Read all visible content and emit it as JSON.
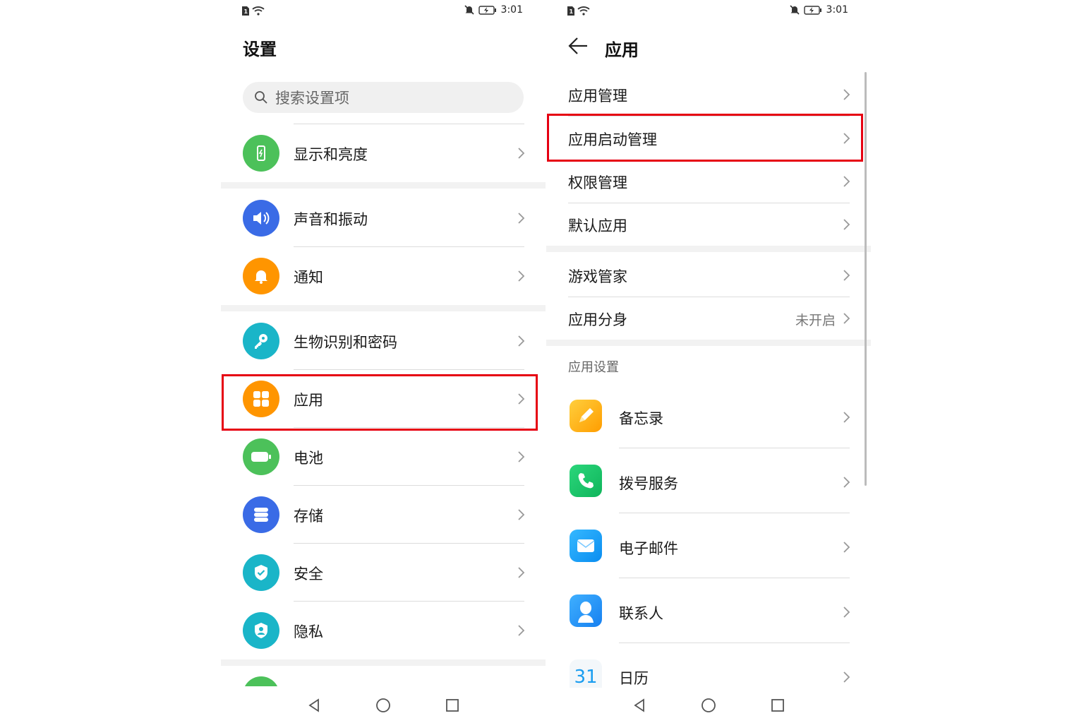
{
  "status_bar": {
    "time": "3:01"
  },
  "left": {
    "title": "设置",
    "search_placeholder": "搜索设置项",
    "items": [
      {
        "label": "显示和亮度",
        "icon": "display-brightness-icon",
        "color": "#4cc15a"
      },
      {
        "label": "声音和振动",
        "icon": "speaker-icon",
        "color": "#3a6be6"
      },
      {
        "label": "通知",
        "icon": "bell-icon",
        "color": "#ff9500"
      },
      {
        "label": "生物识别和密码",
        "icon": "key-icon",
        "color": "#1ab5c8"
      },
      {
        "label": "应用",
        "icon": "apps-grid-icon",
        "color": "#ff9500"
      },
      {
        "label": "电池",
        "icon": "battery-icon",
        "color": "#4cc15a"
      },
      {
        "label": "存储",
        "icon": "storage-icon",
        "color": "#3a6be6"
      },
      {
        "label": "安全",
        "icon": "shield-check-icon",
        "color": "#1ab5c8"
      },
      {
        "label": "隐私",
        "icon": "privacy-shield-icon",
        "color": "#1ab5c8"
      }
    ]
  },
  "right": {
    "title": "应用",
    "items": [
      {
        "label": "应用管理"
      },
      {
        "label": "应用启动管理"
      },
      {
        "label": "权限管理"
      },
      {
        "label": "默认应用"
      },
      {
        "label": "游戏管家"
      },
      {
        "label": "应用分身",
        "value": "未开启"
      }
    ],
    "section_title": "应用设置",
    "apps": [
      {
        "label": "备忘录",
        "icon": "notepad-icon"
      },
      {
        "label": "拨号服务",
        "icon": "phone-icon"
      },
      {
        "label": "电子邮件",
        "icon": "mail-icon"
      },
      {
        "label": "联系人",
        "icon": "contacts-icon"
      },
      {
        "label": "日历",
        "icon": "calendar-icon",
        "icon_text": "31"
      }
    ]
  },
  "colors": {
    "highlight": "#e60012",
    "accent_blue": "#0a59f7"
  }
}
